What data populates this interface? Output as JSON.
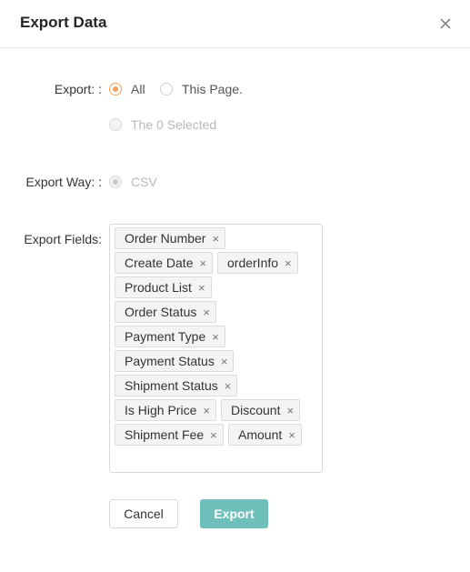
{
  "dialog": {
    "title": "Export Data"
  },
  "export": {
    "label": "Export: :",
    "options": [
      {
        "label": "All",
        "checked": true,
        "disabled": false
      },
      {
        "label": "This Page.",
        "checked": false,
        "disabled": false
      },
      {
        "label": "The 0 Selected",
        "checked": false,
        "disabled": true
      }
    ]
  },
  "export_way": {
    "label": "Export Way: :",
    "option": {
      "label": "CSV",
      "checked": true,
      "disabled": true
    }
  },
  "export_fields": {
    "label": "Export Fields:",
    "tags": [
      "Order Number",
      "Create Date",
      "orderInfo",
      "Product List",
      "Order Status",
      "Payment Type",
      "Payment Status",
      "Shipment Status",
      "Is High Price",
      "Discount",
      "Shipment Fee",
      "Amount"
    ],
    "remove_glyph": "×"
  },
  "buttons": {
    "cancel": "Cancel",
    "export": "Export"
  },
  "colors": {
    "accent": "#f0a35a",
    "primary_button": "#6fc0bb"
  }
}
